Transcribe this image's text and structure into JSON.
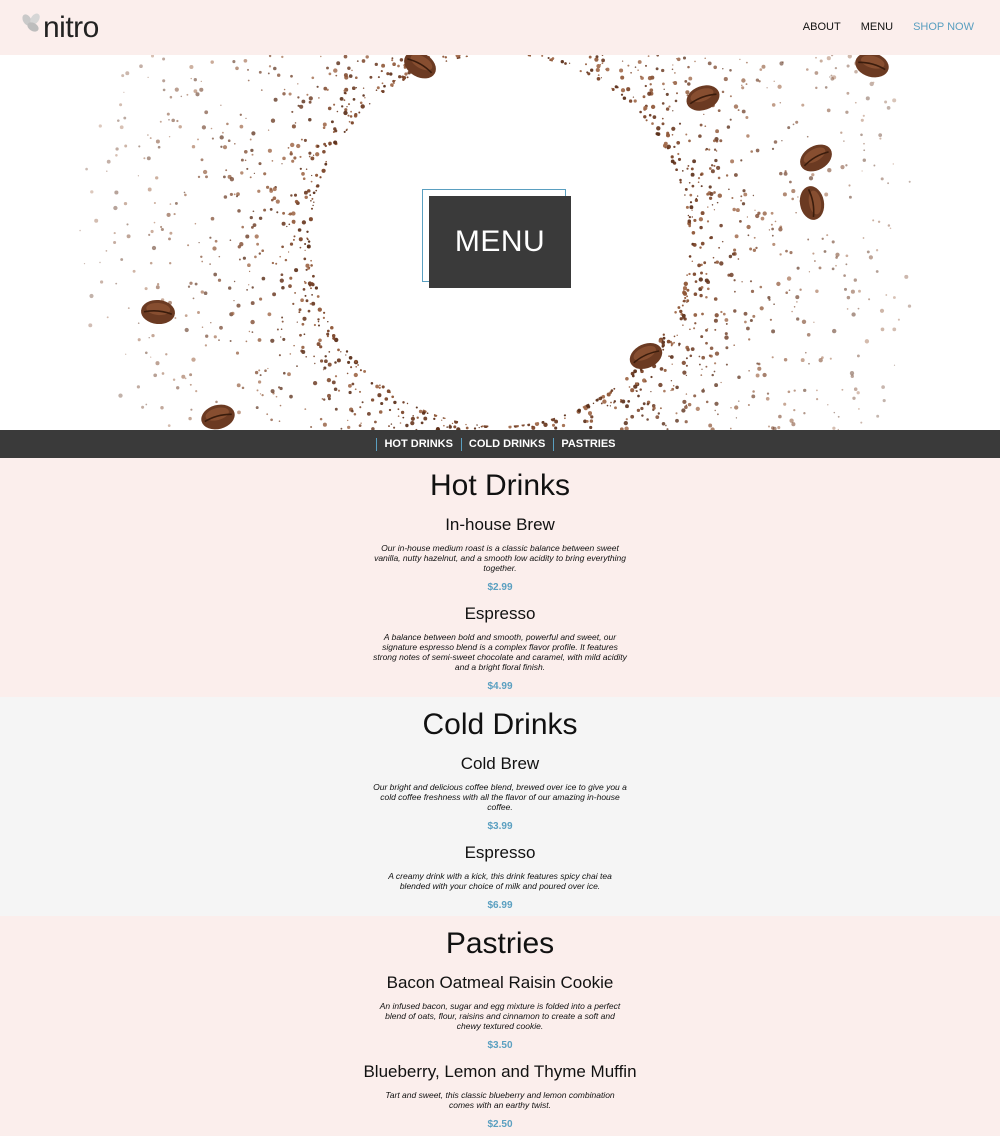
{
  "brand": {
    "name": "nitro",
    "icon": "coffee-bean-logo-icon"
  },
  "nav": {
    "about": "ABOUT",
    "menu": "MENU",
    "shop": "SHOP NOW"
  },
  "hero": {
    "label": "MENU"
  },
  "categories": [
    "HOT DRINKS",
    "COLD DRINKS",
    "PASTRIES"
  ],
  "colors": {
    "accent": "#5a9fc0",
    "dark": "#3a3a3a",
    "pink_bg": "#fbeeec",
    "grey_bg": "#f5f5f5",
    "coffee": "#6b3a22"
  },
  "sections": [
    {
      "title": "Hot Drinks",
      "items": [
        {
          "name": "In-house Brew",
          "desc": "Our in-house medium roast is a classic balance between sweet vanilla, nutty hazelnut, and a smooth low acidity to bring everything together.",
          "price": "$2.99"
        },
        {
          "name": "Espresso",
          "desc": "A balance between bold and smooth, powerful and sweet, our signature espresso blend is a complex flavor profile. It features strong notes of semi-sweet chocolate and caramel, with mild acidity and a bright floral finish.",
          "price": "$4.99"
        }
      ]
    },
    {
      "title": "Cold Drinks",
      "items": [
        {
          "name": "Cold Brew",
          "desc": "Our bright and delicious coffee blend, brewed over ice to give you a cold coffee freshness with all the flavor of our amazing in-house coffee.",
          "price": "$3.99"
        },
        {
          "name": "Espresso",
          "desc": "A creamy drink with a kick, this drink features spicy chai tea blended with your choice of milk and poured over ice.",
          "price": "$6.99"
        }
      ]
    },
    {
      "title": "Pastries",
      "items": [
        {
          "name": "Bacon Oatmeal Raisin Cookie",
          "desc": "An infused bacon, sugar and egg mixture is folded into a perfect blend of oats, flour, raisins and cinnamon to create a soft and chewy textured cookie.",
          "price": "$3.50"
        },
        {
          "name": "Blueberry, Lemon and Thyme Muffin",
          "desc": "Tart and sweet, this classic blueberry and lemon combination comes with an earthy twist.",
          "price": "$2.50"
        }
      ]
    }
  ]
}
